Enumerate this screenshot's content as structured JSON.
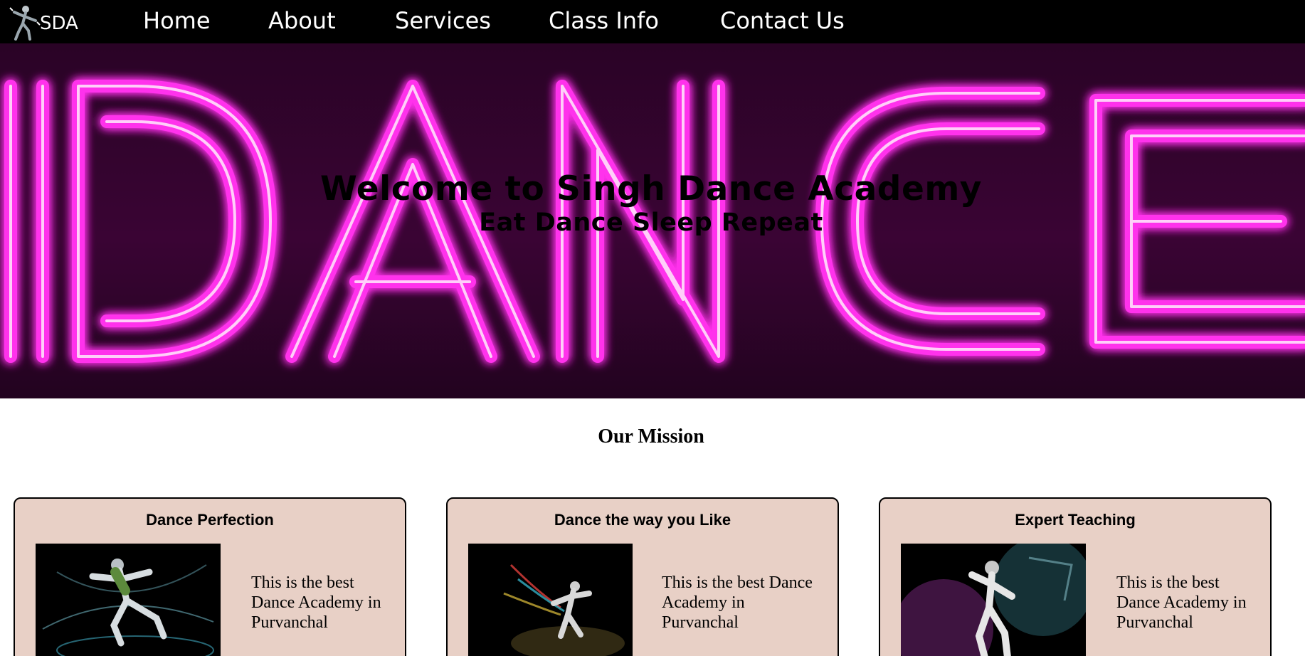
{
  "nav": {
    "logo_text": "SDA",
    "links": [
      "Home",
      "About",
      "Services",
      "Class Info",
      "Contact Us"
    ]
  },
  "hero": {
    "neon_word": "DANCE",
    "title": "Welcome to Singh Dance Academy",
    "subtitle": "Eat Dance Sleep Repeat",
    "neon_color": "#ff3cf0"
  },
  "mission": {
    "heading": "Our Mission",
    "cards": [
      {
        "title": "Dance Perfection",
        "text": "This is the best Dance Academy in Purvanchal"
      },
      {
        "title": "Dance the way you Like",
        "text": "This is the best Dance Academy in Purvanchal"
      },
      {
        "title": "Expert Teaching",
        "text": "This is the best Dance Academy in Purvanchal"
      }
    ],
    "card_bg": "#e8d0c6"
  }
}
